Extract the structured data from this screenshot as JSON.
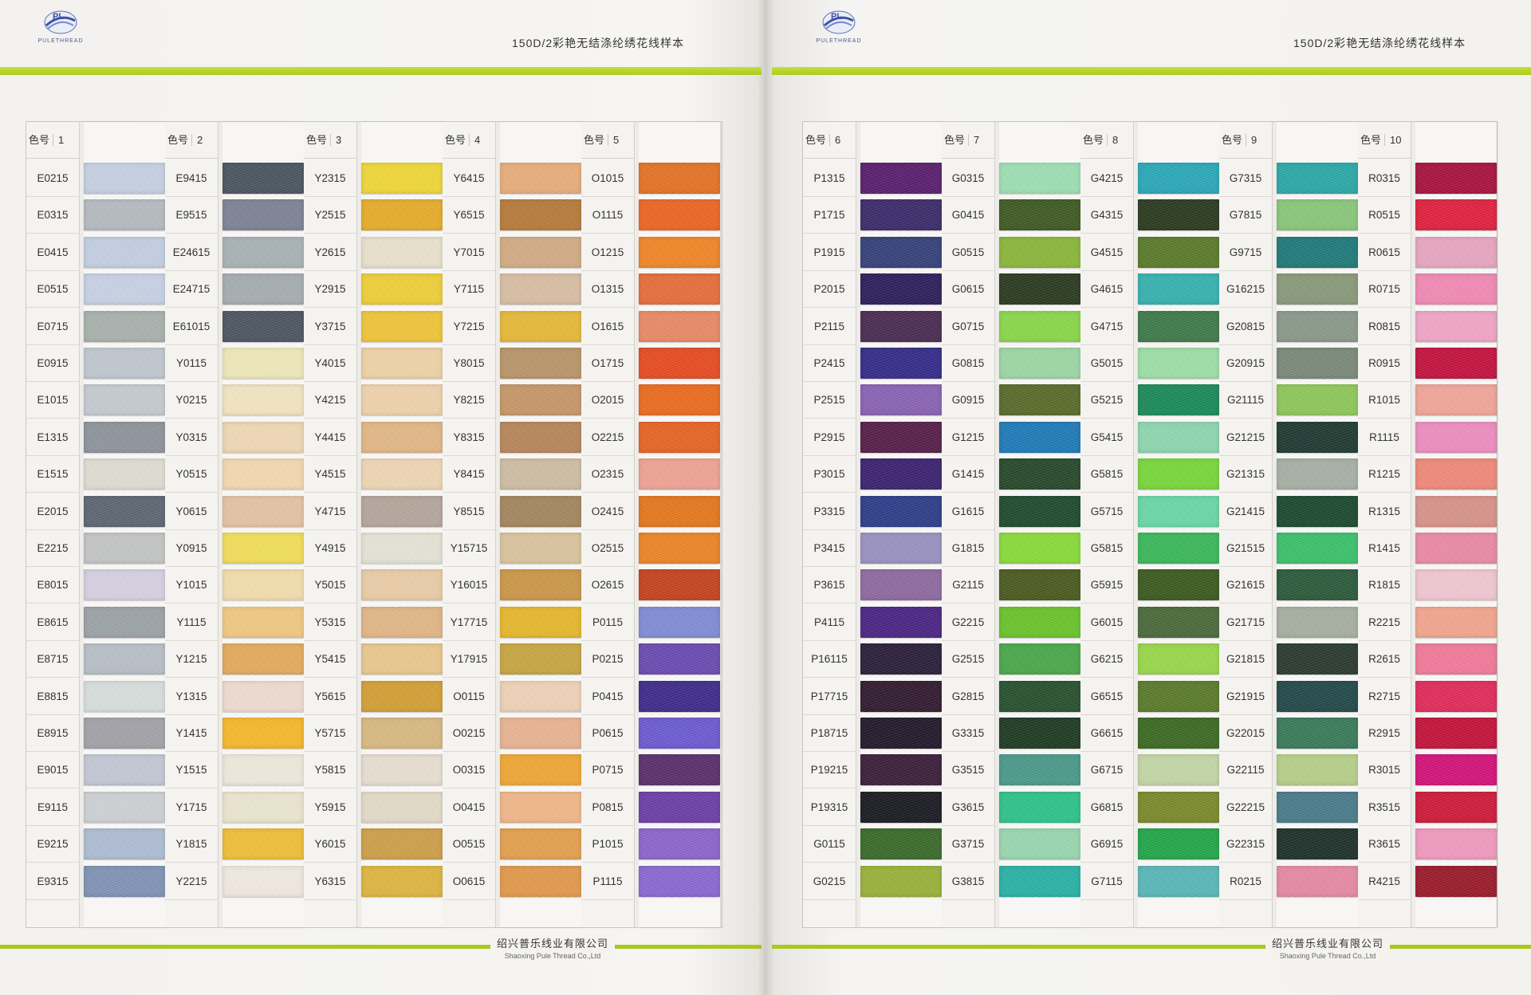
{
  "pages": [
    {
      "title": "150D/2彩艳无结涤纶绣花线样本",
      "company_cn": "绍兴普乐线业有限公司",
      "company_en": "Shaoxing Pule Thread Co.,Ltd",
      "logo_text": "PULETHREAD",
      "groups": [
        {
          "label": "色号",
          "number": "1",
          "codes": [
            "E0215",
            "E0315",
            "E0415",
            "E0515",
            "E0715",
            "E0915",
            "E1015",
            "E1315",
            "E1515",
            "E2015",
            "E2215",
            "E8015",
            "E8615",
            "E8715",
            "E8815",
            "E8915",
            "E9015",
            "E9115",
            "E9215",
            "E9315"
          ],
          "colors": [
            "#c8d2e4",
            "#b7bcc2",
            "#c4d0e4",
            "#c9d3e6",
            "#a9b2ae",
            "#c2c9d2",
            "#c6ccd2",
            "#8e959c",
            "#e1ded5",
            "#5d6672",
            "#c4c7c6",
            "#d7d2e3",
            "#9ca3a8",
            "#b8c0c7",
            "#d8e0de",
            "#a4a3aa",
            "#c4c9d6",
            "#cfd3d6",
            "#afbed4",
            "#8094b6"
          ]
        },
        {
          "label": "色号",
          "number": "2",
          "codes": [
            "E9415",
            "E9515",
            "E24615",
            "E24715",
            "E61015",
            "Y0115",
            "Y0215",
            "Y0315",
            "Y0515",
            "Y0615",
            "Y0915",
            "Y1015",
            "Y1115",
            "Y1215",
            "Y1315",
            "Y1415",
            "Y1515",
            "Y1715",
            "Y1815",
            "Y2215"
          ],
          "colors": [
            "#4a5560",
            "#7d8396",
            "#a9b3b5",
            "#a6aeb3",
            "#4d5562",
            "#f1eaba",
            "#f4e7c2",
            "#f1d9b6",
            "#f6d9b2",
            "#e7c4a4",
            "#f2df5a",
            "#f3dfae",
            "#f2c982",
            "#e6ab5c",
            "#f1ddd1",
            "#f6b92c",
            "#efebdd",
            "#ece7cf",
            "#f0c03a",
            "#f3ebe2"
          ]
        },
        {
          "label": "色号",
          "number": "3",
          "codes": [
            "Y2315",
            "Y2515",
            "Y2615",
            "Y2915",
            "Y3715",
            "Y4015",
            "Y4215",
            "Y4415",
            "Y4515",
            "Y4715",
            "Y4915",
            "Y5015",
            "Y5315",
            "Y5415",
            "Y5615",
            "Y5715",
            "Y5815",
            "Y5915",
            "Y6015",
            "Y6315"
          ],
          "colors": [
            "#f1d838",
            "#e8ad2a",
            "#ebe3cd",
            "#efd138",
            "#f2c63a",
            "#f1d4a8",
            "#f1d4ae",
            "#e3b886",
            "#f0d8b6",
            "#b6a79c",
            "#e5e6d6",
            "#eccda8",
            "#e2b787",
            "#ebc98e",
            "#d5a035",
            "#d9ba82",
            "#e9e0d2",
            "#e5dcca",
            "#cfa04a",
            "#dfb640"
          ]
        },
        {
          "label": "色号",
          "number": "4",
          "codes": [
            "Y6415",
            "Y6515",
            "Y7015",
            "Y7115",
            "Y7215",
            "Y8015",
            "Y8215",
            "Y8315",
            "Y8415",
            "Y8515",
            "Y15715",
            "Y16015",
            "Y17715",
            "Y17915",
            "O0115",
            "O0215",
            "O0315",
            "O0415",
            "O0515",
            "O0615"
          ],
          "colors": [
            "#e9ae7c",
            "#b77b3a",
            "#d3ad84",
            "#d9c0a4",
            "#e8ba3a",
            "#b9966a",
            "#c79868",
            "#b8875a",
            "#cfbfa5",
            "#a58760",
            "#dcc59f",
            "#cc9848",
            "#e8b82c",
            "#c8a642",
            "#f1d3b9",
            "#eab592",
            "#f1a836",
            "#f2b88a",
            "#e4a14e",
            "#e49a4c"
          ]
        },
        {
          "label": "色号",
          "number": "5",
          "codes": [
            "O1015",
            "O1115",
            "O1215",
            "O1315",
            "O1615",
            "O1715",
            "O2015",
            "O2215",
            "O2315",
            "O2415",
            "O2515",
            "O2615",
            "P0115",
            "P0215",
            "P0415",
            "P0615",
            "P0715",
            "P0815",
            "P1015",
            "P1115"
          ],
          "colors": [
            "#e57326",
            "#ef6522",
            "#f28626",
            "#e86d3a",
            "#ea8a66",
            "#e84b22",
            "#ec6b1e",
            "#e86424",
            "#f0a494",
            "#e6781c",
            "#ed8526",
            "#c5431e",
            "#7f8dd6",
            "#6a4ab2",
            "#3e2a8c",
            "#6c5ad2",
            "#5a2e6a",
            "#6b3ea6",
            "#8d64cc",
            "#8b68d2"
          ]
        }
      ]
    },
    {
      "title": "150D/2彩艳无结涤纶绣花线样本",
      "company_cn": "绍兴普乐线业有限公司",
      "company_en": "Shaoxing Pule Thread Co.,Ltd",
      "logo_text": "PULETHREAD",
      "groups": [
        {
          "label": "色号",
          "number": "6",
          "codes": [
            "P1315",
            "P1715",
            "P1915",
            "P2015",
            "P2115",
            "P2415",
            "P2515",
            "P2915",
            "P3015",
            "P3315",
            "P3415",
            "P3615",
            "P4115",
            "P16115",
            "P17715",
            "P18715",
            "P19215",
            "P19315",
            "G0115",
            "G0215"
          ],
          "colors": [
            "#5a1e6e",
            "#3b2a6a",
            "#35407a",
            "#2c1e5a",
            "#4b2a52",
            "#342a8a",
            "#8a62b4",
            "#561e4a",
            "#3b2270",
            "#2c3c8a",
            "#9a92c2",
            "#8e6aa0",
            "#4a2484",
            "#2a1e3a",
            "#301a2e",
            "#22182a",
            "#3a1e3a",
            "#1a1a22",
            "#3a6a2a",
            "#9ab23a"
          ]
        },
        {
          "label": "色号",
          "number": "7",
          "codes": [
            "G0315",
            "G0415",
            "G0515",
            "G0615",
            "G0715",
            "G0815",
            "G0915",
            "G1215",
            "G1415",
            "G1615",
            "G1815",
            "G2115",
            "G2215",
            "G2515",
            "G2815",
            "G3315",
            "G3515",
            "G3615",
            "G3715",
            "G3815"
          ],
          "colors": [
            "#9ee0b4",
            "#3e5a22",
            "#8ab83a",
            "#2a3a20",
            "#8ad84a",
            "#9ed8a6",
            "#5a6a2a",
            "#1e7ab8",
            "#26482a",
            "#1e4a2e",
            "#8adc3a",
            "#4a5a1e",
            "#6ac42a",
            "#4aa84a",
            "#26502e",
            "#1e3a22",
            "#4a9a8a",
            "#2ec48a",
            "#9ad8b0",
            "#2ab2a6"
          ]
        },
        {
          "label": "色号",
          "number": "8",
          "codes": [
            "G4215",
            "G4315",
            "G4515",
            "G4615",
            "G4715",
            "G5015",
            "G5215",
            "G5415",
            "G5815",
            "G5715",
            "G5815",
            "G5915",
            "G6015",
            "G6215",
            "G6515",
            "G6615",
            "G6715",
            "G6815",
            "G6915",
            "G7115"
          ],
          "colors": [
            "#2aa8b8",
            "#2a3a1e",
            "#5a7a2a",
            "#36b2b0",
            "#3e7a4a",
            "#9ee0a8",
            "#1a8a5a",
            "#8ed8b0",
            "#78d83a",
            "#6ad8a8",
            "#3ab85a",
            "#3a5a1e",
            "#4a6a3a",
            "#9ad84a",
            "#5a7a2a",
            "#3a6a22",
            "#c4d8a6",
            "#7a8a2a",
            "#22a64a",
            "#5ab8b8"
          ]
        },
        {
          "label": "色号",
          "number": "9",
          "codes": [
            "G7315",
            "G7815",
            "G9715",
            "G16215",
            "G20815",
            "G20915",
            "G21115",
            "G21215",
            "G21315",
            "G21415",
            "G21515",
            "G21615",
            "G21715",
            "G21815",
            "G21915",
            "G22015",
            "G22115",
            "G22215",
            "G22315",
            "R0215"
          ],
          "colors": [
            "#2aa8a8",
            "#8ac87a",
            "#1e7a7a",
            "#8a9a7a",
            "#8a9a8a",
            "#7a8a7a",
            "#8ec85a",
            "#1e3a32",
            "#a8b0a6",
            "#1a4a2e",
            "#3ac26a",
            "#2a5a3a",
            "#a6b0a0",
            "#2a3a2e",
            "#22484a",
            "#3a7a5a",
            "#b8d08a",
            "#4a7a8a",
            "#1e302a",
            "#e88aa6"
          ]
        },
        {
          "label": "色号",
          "number": "10",
          "codes": [
            "R0315",
            "R0515",
            "R0615",
            "R0715",
            "R0815",
            "R0915",
            "R1015",
            "R1115",
            "R1215",
            "R1315",
            "R1415",
            "R1815",
            "R2215",
            "R2615",
            "R2715",
            "R2915",
            "R3015",
            "R3515",
            "R3615",
            "R4215"
          ],
          "colors": [
            "#a8123e",
            "#e2203e",
            "#eaa6c2",
            "#f28ab6",
            "#f2a6c8",
            "#c4123e",
            "#f2a69a",
            "#ee8ec2",
            "#f08a7a",
            "#d8948a",
            "#ec8aa8",
            "#f2c8d4",
            "#f4a690",
            "#f27a9a",
            "#e22a5a",
            "#c4123a",
            "#d4127a",
            "#ce1a3a",
            "#f29ac0",
            "#9a1a2a"
          ]
        }
      ]
    }
  ]
}
